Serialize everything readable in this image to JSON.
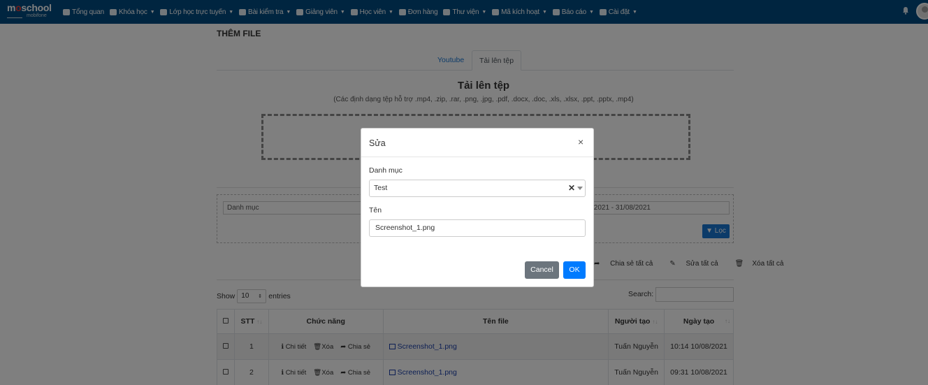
{
  "navbar": {
    "logo_main_pre": "m",
    "logo_main_o": "o",
    "logo_main_post": "school",
    "logo_sub": "mobifone",
    "items": [
      {
        "label": "Tổng quan",
        "icon": "dashboard-icon",
        "dropdown": false
      },
      {
        "label": "Khóa học",
        "icon": "course-icon",
        "dropdown": true
      },
      {
        "label": "Lớp học trực tuyến",
        "icon": "video-icon",
        "dropdown": true
      },
      {
        "label": "Bài kiểm tra",
        "icon": "question-icon",
        "dropdown": true
      },
      {
        "label": "Giảng viên",
        "icon": "users-icon",
        "dropdown": true
      },
      {
        "label": "Học viên",
        "icon": "user-icon",
        "dropdown": true
      },
      {
        "label": "Đơn hàng",
        "icon": "cart-icon",
        "dropdown": false
      },
      {
        "label": "Thư viện",
        "icon": "book-icon",
        "dropdown": true
      },
      {
        "label": "Mã kích hoạt",
        "icon": "code-icon",
        "dropdown": true
      },
      {
        "label": "Báo cáo",
        "icon": "chart-icon",
        "dropdown": true
      },
      {
        "label": "Cài đặt",
        "icon": "cog-icon",
        "dropdown": true
      }
    ]
  },
  "page": {
    "title": "THÊM FILE",
    "tabs": [
      {
        "label": "Youtube"
      },
      {
        "label": "Tải lên tệp"
      }
    ],
    "upload_title": "Tải lên tệp",
    "upload_subtitle": "(Các định dạng tệp hỗ trợ .mp4, .zip, .rar, .png, .jpg, .pdf, .docx, .doc, .xls, .xlsx, .ppt, .pptx, .mp4)"
  },
  "filter": {
    "category_placeholder": "Danh mục",
    "date_range": "/2021 - 31/08/2021",
    "filter_button": "Lọc"
  },
  "bulk_actions": {
    "share_all": "Chia sẻ tất cả",
    "edit_all": "Sửa tất cả",
    "delete_all": "Xóa tất cả"
  },
  "table_controls": {
    "show": "Show",
    "entries_value": "10",
    "entries": "entries",
    "search": "Search:"
  },
  "table": {
    "headers": {
      "stt": "STT",
      "actions": "Chức năng",
      "file_name": "Tên file",
      "creator": "Người tạo",
      "created": "Ngày tạo"
    },
    "action_labels": {
      "detail": "Chi tiết",
      "delete": "Xóa",
      "share": "Chia sẻ"
    },
    "rows": [
      {
        "stt": "1",
        "file_name": "Screenshot_1.png",
        "creator": "Tuấn Nguyễn",
        "created": "10:14 10/08/2021"
      },
      {
        "stt": "2",
        "file_name": "Screenshot_1.png",
        "creator": "Tuấn Nguyễn",
        "created": "09:31 10/08/2021"
      }
    ]
  },
  "modal": {
    "title": "Sửa",
    "close": "×",
    "category_label": "Danh mục",
    "category_value": "Test",
    "name_label": "Tên",
    "name_value": "Screenshot_1.png",
    "cancel": "Cancel",
    "ok": "OK"
  },
  "colors": {
    "navbar": "#004a80",
    "primary": "#007bff",
    "secondary": "#6c757d",
    "link": "#1a3fa8"
  }
}
